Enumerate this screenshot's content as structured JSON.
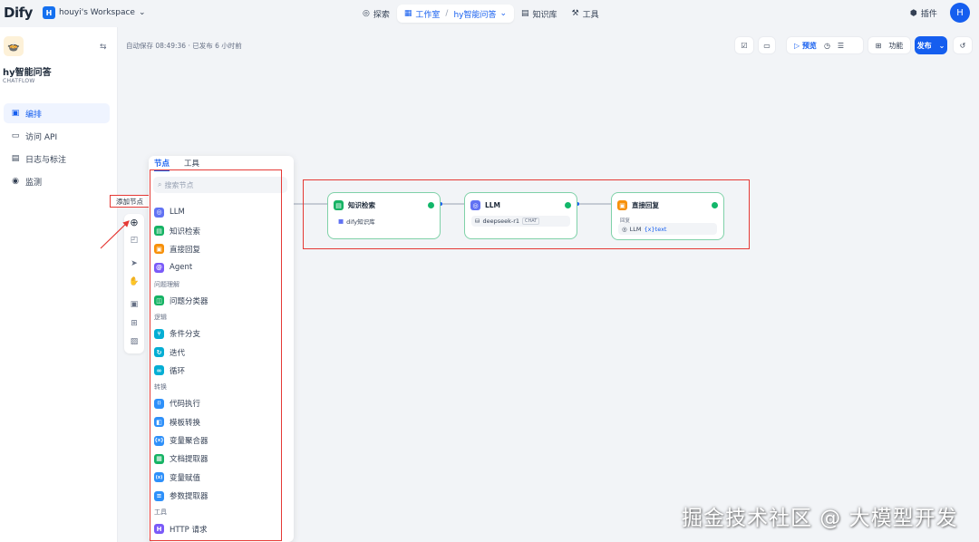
{
  "header": {
    "logo": "Dify",
    "workspace_initial": "H",
    "workspace_name": "houyi's Workspace",
    "nav": [
      {
        "label": "探索",
        "icon": "compass-icon"
      },
      {
        "label": "工作室",
        "icon": "studio-icon"
      },
      {
        "label": "hy智能问答",
        "icon": "chevron-down-icon"
      },
      {
        "label": "知识库",
        "icon": "book-icon"
      },
      {
        "label": "工具",
        "icon": "tool-icon"
      }
    ],
    "plugin_label": "插件",
    "user_initial": "H"
  },
  "sidebar": {
    "app_name": "hy智能问答",
    "app_type": "CHATFLOW",
    "menu": [
      {
        "label": "编排",
        "icon": "layout-icon"
      },
      {
        "label": "访问 API",
        "icon": "terminal-icon"
      },
      {
        "label": "日志与标注",
        "icon": "file-icon"
      },
      {
        "label": "监测",
        "icon": "monitor-icon"
      }
    ]
  },
  "canvas": {
    "autosave": "自动保存 08:49:36 · 已发布 6 小时前",
    "toolbar": {
      "preview": "预览",
      "features": "功能",
      "publish": "发布"
    },
    "hint_label": "添加节点"
  },
  "panel": {
    "tabs": [
      "节点",
      "工具"
    ],
    "search_placeholder": "搜索节点",
    "items": [
      {
        "type": "item",
        "label": "LLM",
        "color": "#6172f3",
        "glyph": "◎"
      },
      {
        "type": "item",
        "label": "知识检索",
        "color": "#16b364",
        "glyph": "▤"
      },
      {
        "type": "item",
        "label": "直接回复",
        "color": "#f79009",
        "glyph": "▣"
      },
      {
        "type": "item",
        "label": "Agent",
        "color": "#7a5af8",
        "glyph": "@"
      },
      {
        "type": "cat",
        "label": "问题理解"
      },
      {
        "type": "item",
        "label": "问题分类器",
        "color": "#16b364",
        "glyph": "◫"
      },
      {
        "type": "cat",
        "label": "逻辑"
      },
      {
        "type": "item",
        "label": "条件分支",
        "color": "#06aed4",
        "glyph": "⑂"
      },
      {
        "type": "item",
        "label": "迭代",
        "color": "#06aed4",
        "glyph": "↻"
      },
      {
        "type": "item",
        "label": "循环",
        "color": "#06aed4",
        "glyph": "∞"
      },
      {
        "type": "cat",
        "label": "转换"
      },
      {
        "type": "item",
        "label": "代码执行",
        "color": "#2e90fa",
        "glyph": "⟨⟩"
      },
      {
        "type": "item",
        "label": "模板转换",
        "color": "#2e90fa",
        "glyph": "◧"
      },
      {
        "type": "item",
        "label": "变量聚合器",
        "color": "#2e90fa",
        "glyph": "{x}"
      },
      {
        "type": "item",
        "label": "文档提取器",
        "color": "#16b364",
        "glyph": "▦"
      },
      {
        "type": "item",
        "label": "变量赋值",
        "color": "#2e90fa",
        "glyph": "(x)"
      },
      {
        "type": "item",
        "label": "参数提取器",
        "color": "#2e90fa",
        "glyph": "≡"
      },
      {
        "type": "cat",
        "label": "工具"
      },
      {
        "type": "item",
        "label": "HTTP 请求",
        "color": "#7a5af8",
        "glyph": "H"
      }
    ]
  },
  "nodes": [
    {
      "title": "知识检索",
      "color": "#16b364",
      "body": "dify知识库"
    },
    {
      "title": "LLM",
      "color": "#6172f3",
      "body": "deepseek-r1",
      "badge": "CHAT"
    },
    {
      "title": "直接回复",
      "color": "#f79009",
      "label": "回复",
      "body": "LLM",
      "var": "{x}text"
    }
  ],
  "watermark": "掘金技术社区 @ 大模型开发"
}
